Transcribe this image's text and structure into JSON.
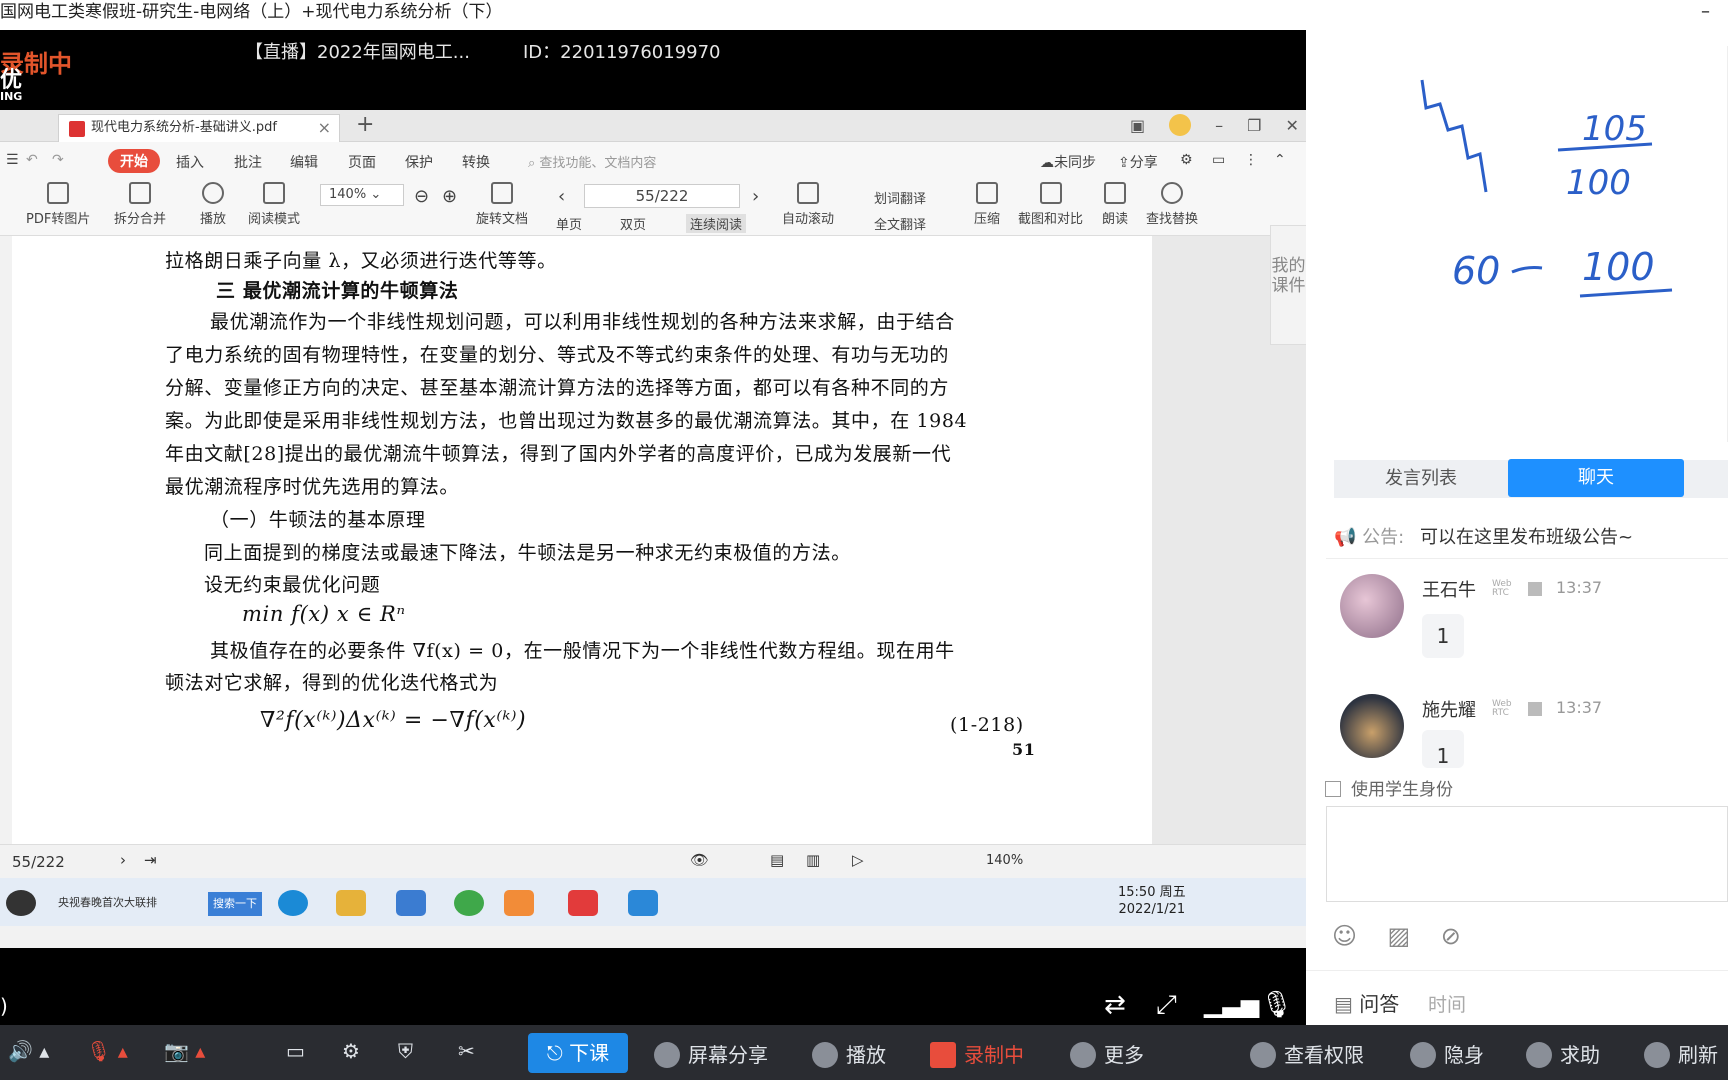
{
  "window": {
    "title": "国网电工类寒假班-研究生-电网络（上）+现代电力系统分析（下）",
    "minimize": "–"
  },
  "stream": {
    "recording_badge": "录制中",
    "logo_text": "优",
    "logo_sub": "ING",
    "live_title": "【直播】2022年国网电工...",
    "live_id": "ID：22011976019970"
  },
  "wps": {
    "doc_tab": "现代电力系统分析-基础讲义.pdf",
    "menu": [
      "开始",
      "插入",
      "批注",
      "编辑",
      "页面",
      "保护",
      "转换"
    ],
    "search_placeholder": "查找功能、文档内容",
    "sync_status": "未同步",
    "share": "分享",
    "tools": [
      "PDF转图片",
      "拆分合并",
      "播放",
      "阅读模式",
      "旋转文档",
      "单页",
      "双页",
      "连续阅读",
      "自动滚动",
      "划词翻译",
      "全文翻译",
      "压缩",
      "截图和对比",
      "朗读",
      "查找替换"
    ],
    "zoom": "140%",
    "page": "55/222",
    "side_tab": "我的课件"
  },
  "document": {
    "lines": [
      "拉格朗日乘子向量 λ，又必须进行迭代等等。",
      "三  最优潮流计算的牛顿算法",
      "最优潮流作为一个非线性规划问题，可以利用非线性规划的各种方法来求解，由于结合",
      "了电力系统的固有物理特性，在变量的划分、等式及不等式约束条件的处理、有功与无功的",
      "分解、变量修正方向的决定、甚至基本潮流计算方法的选择等方面，都可以有各种不同的方",
      "案。为此即使是采用非线性规划方法，也曾出现过为数甚多的最优潮流算法。其中，在 1984",
      "年由文献[28]提出的最优潮流牛顿算法，得到了国内外学者的高度评价，已成为发展新一代",
      "最优潮流程序时优先选用的算法。",
      "（一）牛顿法的基本原理",
      "同上面提到的梯度法或最速下降法，牛顿法是另一种求无约束极值的方法。",
      "设无约束最优化问题",
      "min f(x)                x ∈ Rⁿ",
      "其极值存在的必要条件 ∇f(x) = 0，在一般情况下为一个非线性代数方程组。现在用牛",
      "顿法对它求解，得到的优化迭代格式为",
      "∇²f(x⁽ᵏ⁾)Δx⁽ᵏ⁾ = −∇f(x⁽ᵏ⁾)"
    ],
    "eq_number": "(1-218)",
    "page_number": "51"
  },
  "status": {
    "page": "55/222",
    "zoom": "140%"
  },
  "taskbar": {
    "news": "央视春晚首次大联排",
    "search_btn": "搜索一下",
    "time": "15:50 周五",
    "date": "2022/1/21"
  },
  "whiteboard": {
    "notes": [
      "105",
      "100",
      "60",
      "100"
    ]
  },
  "chat": {
    "tabs": [
      "发言列表",
      "聊天"
    ],
    "notice_label": "公告:",
    "notice_text": "可以在这里发布班级公告~",
    "messages": [
      {
        "name": "王石牛",
        "tag": "Web RTC",
        "time": "13:37",
        "text": "1"
      },
      {
        "name": "施先耀",
        "tag": "Web RTC",
        "time": "13:37",
        "text": "1"
      }
    ],
    "student_id": "使用学生身份",
    "qa_label": "问答",
    "qa_time": "时间"
  },
  "classroom_toolbar": {
    "end_class": "下课",
    "screen_share": "屏幕分享",
    "play": "播放",
    "recording": "录制中",
    "more": "更多",
    "permissions": "查看权限",
    "invisible": "隐身",
    "help": "求助",
    "refresh": "刷新"
  },
  "colors": {
    "accent": "#1e90ff",
    "record": "#e84d3c",
    "toolbar_bg": "#2a2c31"
  }
}
